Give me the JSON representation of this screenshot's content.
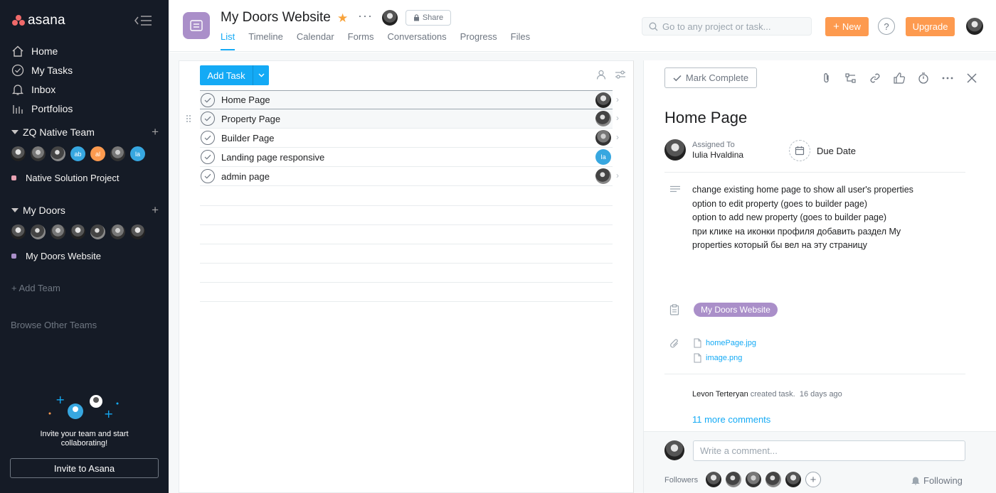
{
  "brand": {
    "name": "asana"
  },
  "sidebar": {
    "nav": [
      {
        "label": "Home",
        "icon": "home-icon"
      },
      {
        "label": "My Tasks",
        "icon": "check-circle-icon"
      },
      {
        "label": "Inbox",
        "icon": "bell-icon"
      },
      {
        "label": "Portfolios",
        "icon": "bar-chart-icon"
      }
    ],
    "teams": [
      {
        "name": "ZQ Native Team",
        "avatars": [
          "photo",
          "photo",
          "photo",
          "ab",
          "al",
          "photo",
          "la"
        ],
        "project": {
          "name": "Native Solution Project",
          "color": "#e8a2b3"
        }
      },
      {
        "name": "My Doors",
        "avatars": [
          "photo",
          "photo",
          "photo",
          "photo",
          "photo",
          "photo",
          "photo"
        ],
        "project": {
          "name": "My Doors Website",
          "color": "#aa8fc9"
        }
      }
    ],
    "add_team": "Add Team",
    "browse_teams": "Browse Other Teams",
    "invite_text": "Invite your team and start collaborating!",
    "invite_button": "Invite to Asana"
  },
  "header": {
    "project_title": "My Doors Website",
    "share_label": "Share",
    "tabs": [
      "List",
      "Timeline",
      "Calendar",
      "Forms",
      "Conversations",
      "Progress",
      "Files"
    ],
    "active_tab": "List",
    "search_placeholder": "Go to any project or task...",
    "new_label": "New",
    "help_label": "?",
    "upgrade_label": "Upgrade"
  },
  "list": {
    "add_task_label": "Add Task",
    "tasks": [
      {
        "name": "Home Page",
        "assignee": "photo"
      },
      {
        "name": "Property Page",
        "assignee": "photo"
      },
      {
        "name": "Builder Page",
        "assignee": "photo"
      },
      {
        "name": "Landing page responsive",
        "assignee": "Ia"
      },
      {
        "name": "admin page",
        "assignee": "photo"
      }
    ]
  },
  "detail": {
    "mark_complete": "Mark Complete",
    "title": "Home Page",
    "assigned_to_label": "Assigned To",
    "assignee_name": "Iulia Hvaldina",
    "due_date_label": "Due Date",
    "description": [
      "change existing home page to show all user's properties",
      "option to edit property (goes to builder page)",
      "option to add new property (goes to builder page)",
      "при клике на иконки профиля добавить раздел My",
      "properties который бы вел на эту страницу"
    ],
    "project_tag": "My Doors Website",
    "attachments": [
      "homePage.jpg",
      "image.png"
    ],
    "activity": {
      "author": "Levon Terteryan",
      "action": "created task.",
      "time": "16 days ago"
    },
    "more_comments": "11 more comments",
    "comment_placeholder": "Write a comment...",
    "followers_label": "Followers",
    "following_label": "Following"
  },
  "colors": {
    "sidebar_bg": "#151b26",
    "accent_blue": "#14aaf5",
    "orange": "#fd9a4f",
    "project_purple": "#aa8fc9"
  }
}
